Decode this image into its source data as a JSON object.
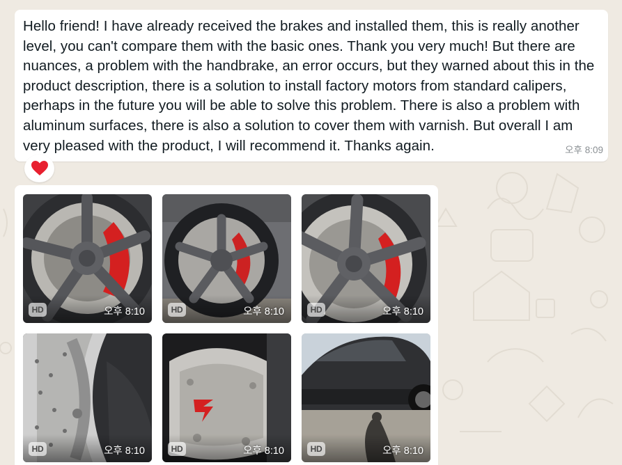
{
  "chat": {
    "message": {
      "text": "Hello friend! I have already received the brakes and installed them, this is really another level, you can't compare them with the basic ones. Thank you very much! But there are nuances, a problem with the handbrake, an error occurs, but they warned about this in the product description, there is a solution to install factory motors from standard calipers, perhaps in the future you will be able to solve this problem. There is also a problem with aluminum surfaces, there is also a solution to cover them with varnish. But overall I am very pleased with the product, I will recommend it. Thanks again.",
      "time": "오후 8:09",
      "reaction": "heart-emoji"
    },
    "album": {
      "photos": [
        {
          "subject": "wheel-with-red-caliper",
          "badge": "HD",
          "time": "오후 8:10"
        },
        {
          "subject": "wheel-side-view",
          "badge": "HD",
          "time": "오후 8:10"
        },
        {
          "subject": "wheel-with-red-caliper",
          "badge": "HD",
          "time": "오후 8:10"
        },
        {
          "subject": "brake-disc-closeup",
          "badge": "HD",
          "time": "오후 8:10"
        },
        {
          "subject": "caliper-with-logo",
          "badge": "HD",
          "time": "오후 8:10"
        },
        {
          "subject": "grey-car-side",
          "badge": "HD",
          "time": "오후 8:10"
        }
      ]
    }
  },
  "colors": {
    "wallpaper": "#efeae2",
    "bubble": "#ffffff",
    "text": "#111b21",
    "timestamp": "#8a8f93",
    "caliper_red": "#d42020",
    "heart": "#e8202f"
  }
}
